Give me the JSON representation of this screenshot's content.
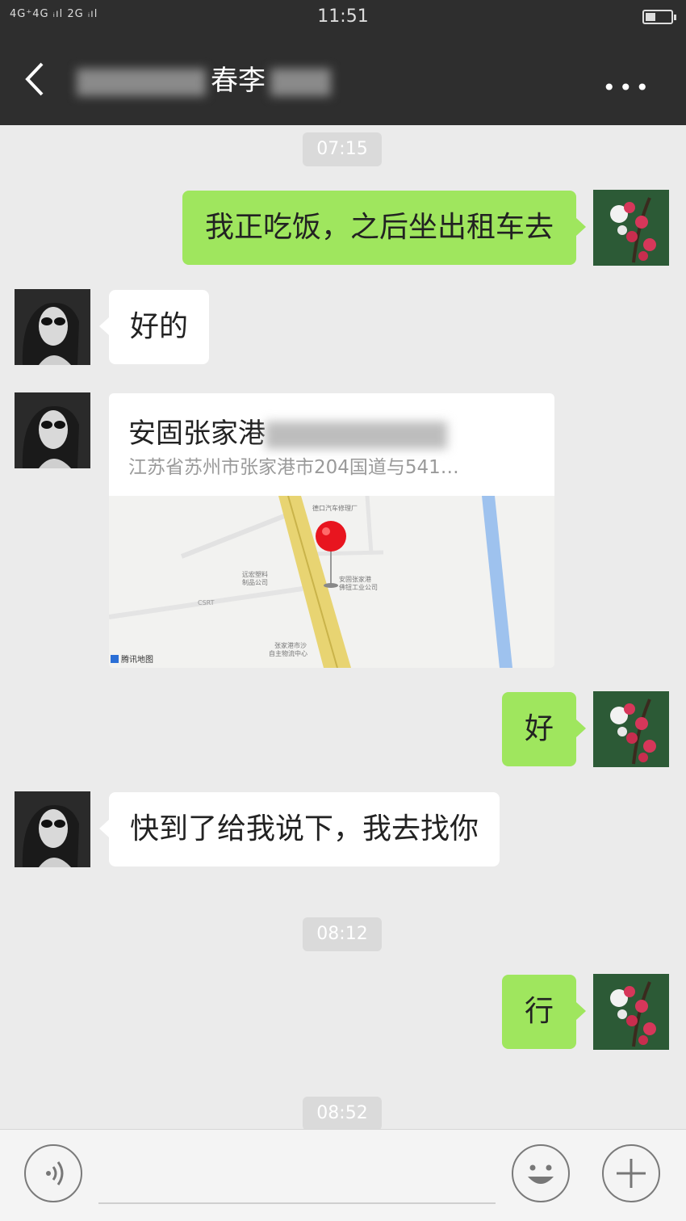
{
  "status_bar": {
    "signal": "4G⁺4G ᵢıl 2G ᵢıl",
    "time": "11:51",
    "battery_level": 0.4
  },
  "header": {
    "back_icon": "chevron-left-icon",
    "title": "春李",
    "more_icon": "more-dots-icon",
    "more_label": "•••"
  },
  "timestamps": [
    "07:15",
    "08:12",
    "08:52"
  ],
  "messages": [
    {
      "sender": "me",
      "text": "我正吃饭，之后坐出租车去"
    },
    {
      "sender": "other",
      "text": "好的"
    },
    {
      "sender": "other",
      "type": "location",
      "title": "安固张家港",
      "address": "江苏省苏州市张家港市204国道与541…"
    },
    {
      "sender": "me",
      "text": "好"
    },
    {
      "sender": "other",
      "text": "快到了给我说下，我去找你"
    },
    {
      "sender": "me",
      "text": "行"
    }
  ],
  "map": {
    "labels": [
      "德口汽车修理厂",
      "远宏塑料\n制品公司",
      "安固张家港\n佛钮工业公司",
      "张家港市沙\n自主物流中心",
      "CSRT"
    ],
    "attribution": "腾讯地图"
  },
  "input_bar": {
    "voice_icon": "voice-icon",
    "emoji_icon": "emoji-icon",
    "add_icon": "plus-icon"
  },
  "colors": {
    "header_bg": "#2e2e2e",
    "chat_bg": "#ebebeb",
    "my_bubble": "#9fe65e",
    "other_bubble": "#ffffff"
  }
}
